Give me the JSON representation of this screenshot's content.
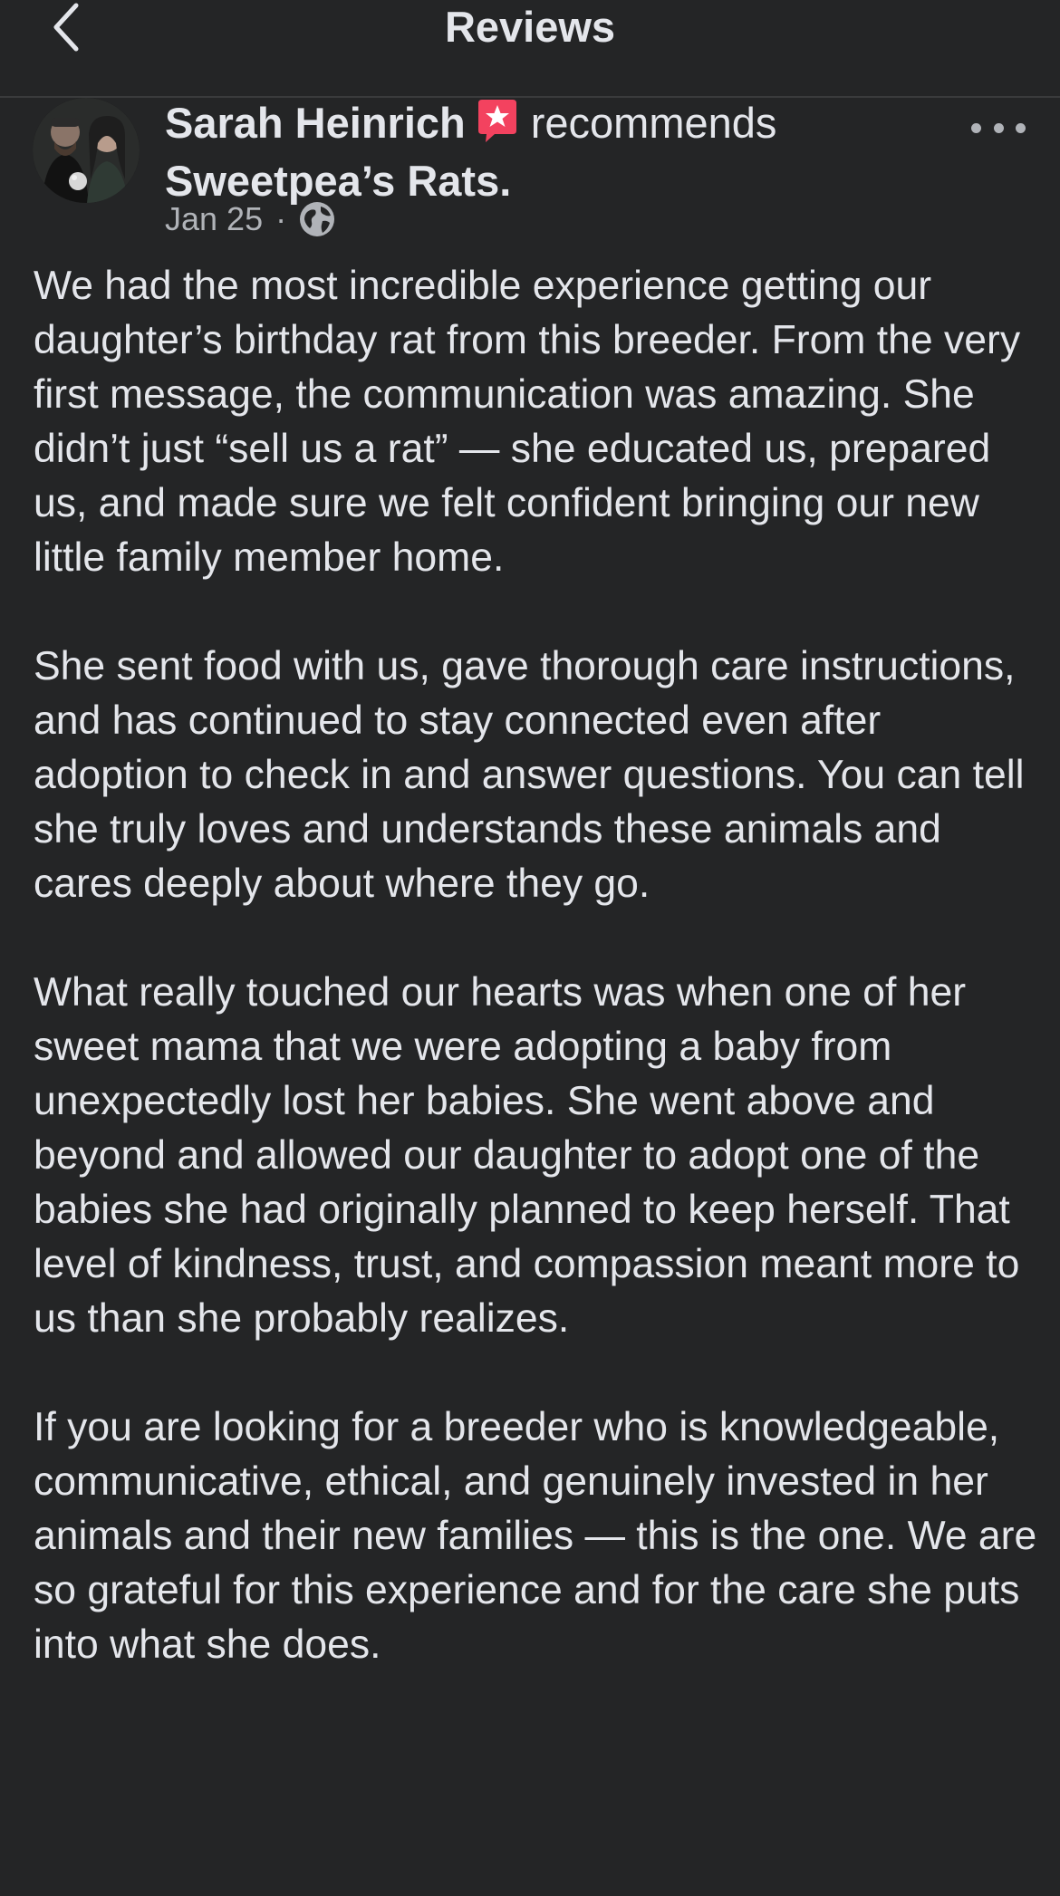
{
  "header": {
    "title": "Reviews",
    "back_icon": "chevron-left-icon"
  },
  "post": {
    "author": "Sarah Heinrich",
    "badge_icon": "recommendation-star-badge-icon",
    "action": "recommends",
    "page_name": "Sweetpea’s Rats.",
    "date": "Jan 25",
    "separator": "·",
    "privacy_icon": "globe-icon",
    "more_icon": "more-horizontal-icon",
    "paragraphs": [
      "We had the most incredible experience getting our daughter’s birthday rat from this breeder. From the very first message, the communication was amazing. She didn’t just “sell us a rat” — she educated us, prepared us, and made sure we felt confident bringing our new little family member home.",
      "She sent food with us, gave thorough care instructions, and has continued to stay connected even after adoption to check in and answer questions. You can tell she truly loves and understands these animals and cares deeply about where they go.",
      "What really touched our hearts was when one of her sweet mama that we were adopting a baby from unexpectedly lost her babies. She went above and beyond and allowed our daughter to adopt one of the babies she had originally planned to keep herself. That level of kindness, trust, and compassion meant more to us than she probably realizes.",
      "If you are looking for a breeder who is knowledgeable, communicative, ethical, and genuinely invested in her animals and their new families — this is the one. We are so grateful for this experience and for the care she puts into what she does."
    ]
  },
  "colors": {
    "background": "#242526",
    "text": "#e4e6eb",
    "secondary_text": "#b0b3b8",
    "badge": "#f3425f"
  }
}
